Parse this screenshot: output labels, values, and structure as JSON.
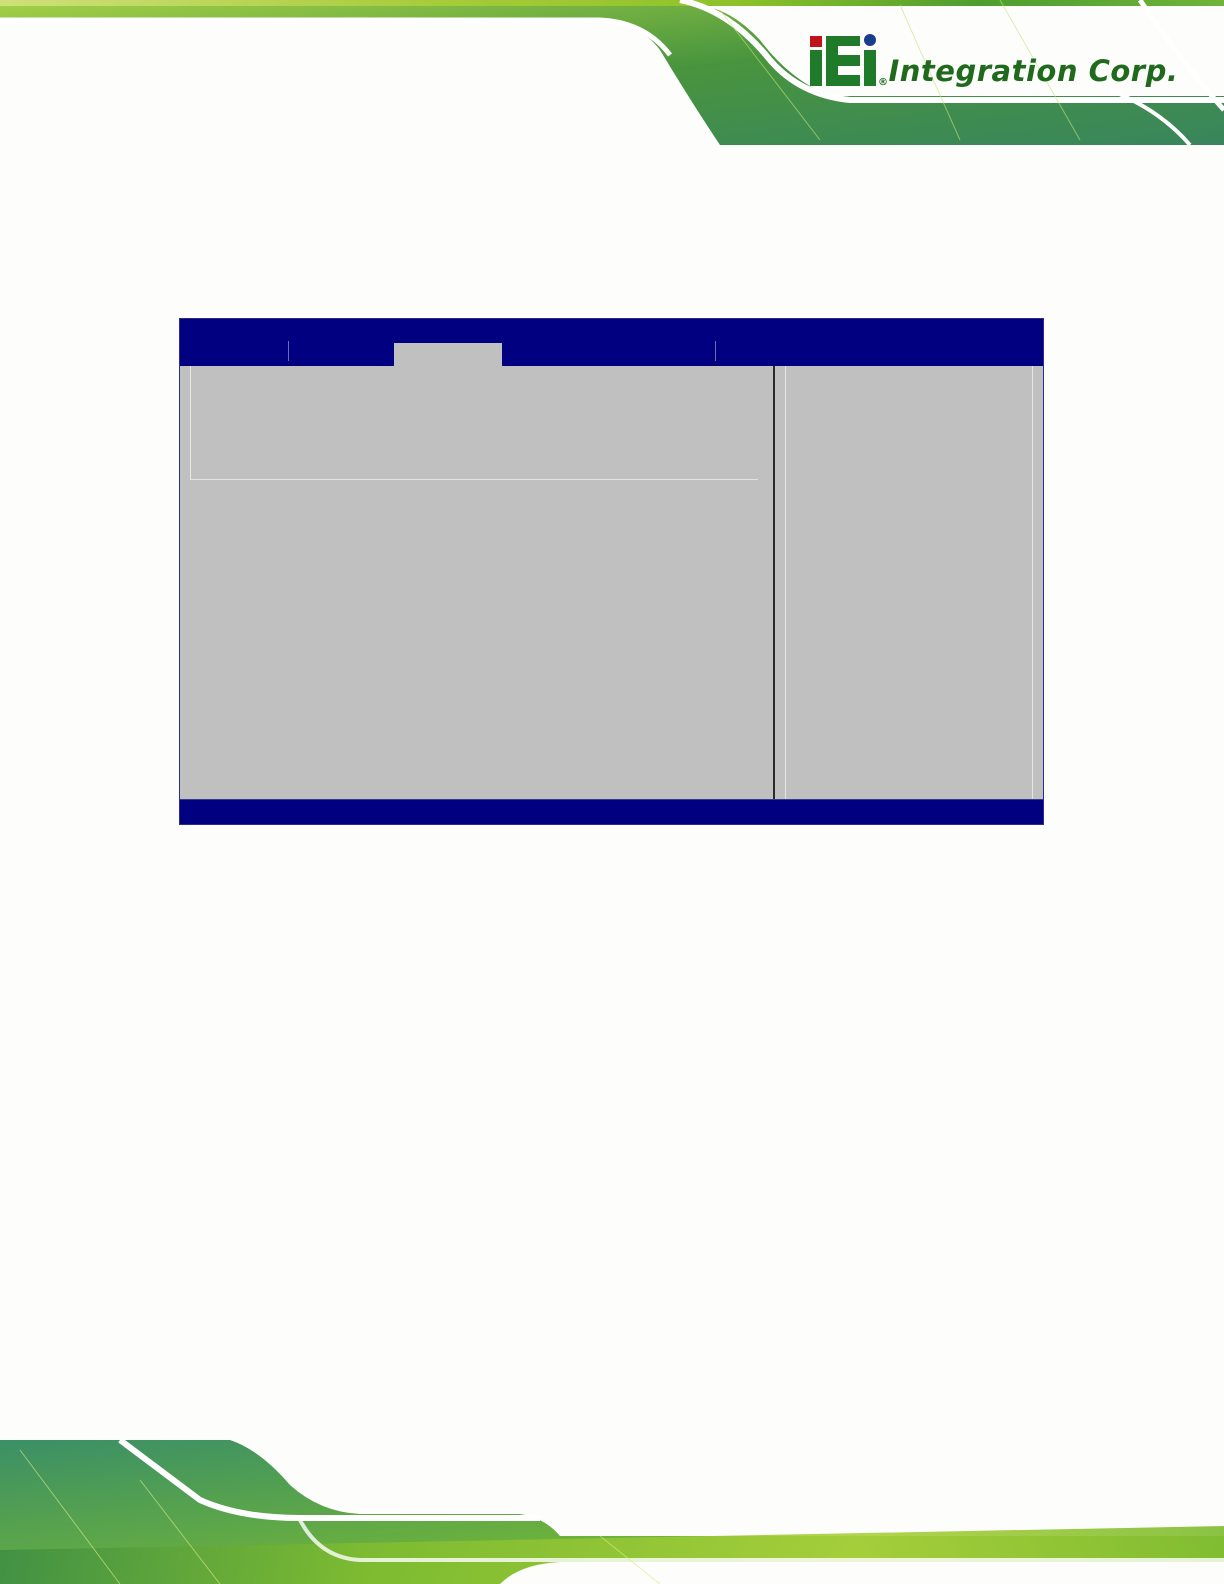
{
  "header": {
    "logo_mark": "iEi",
    "logo_text": "Integration Corp.",
    "registered_mark": "®"
  },
  "colors": {
    "brand_green": "#5aa02c",
    "brand_dark_green": "#1f6a1c",
    "bios_blue": "#000080",
    "bios_gray": "#c0c0c0",
    "logo_red": "#c0141c",
    "logo_blue": "#1a3c8c"
  },
  "bios_screen": {
    "tabs_visible": 3,
    "active_tab_index": 1
  }
}
